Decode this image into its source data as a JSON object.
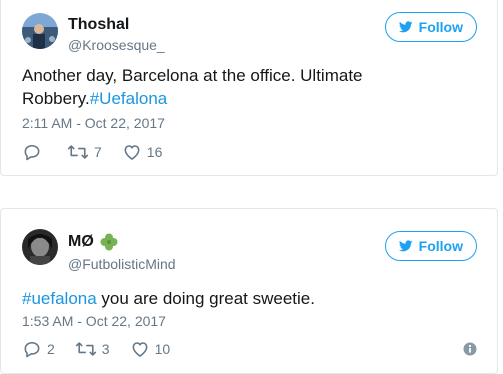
{
  "tweets": [
    {
      "name": "Thoshal",
      "handle": "@Kroosesque_",
      "follow_label": "Follow",
      "text_before": "Another day, Barcelona at the office. Ultimate Robbery.",
      "hashtag": "#Uefalona",
      "text_after": "",
      "timestamp": "2:11 AM - Oct 22, 2017",
      "reply_count": "",
      "retweet_count": "7",
      "like_count": "16",
      "avatar_icon": "crowd-photo"
    },
    {
      "name": "MØ",
      "name_emoji_icon": "four-leaf-clover-icon",
      "handle": "@FutbolisticMind",
      "follow_label": "Follow",
      "text_before": "",
      "hashtag": "#uefalona",
      "text_after": " you are doing great sweetie.",
      "timestamp": "1:53 AM - Oct 22, 2017",
      "reply_count": "2",
      "retweet_count": "3",
      "like_count": "10",
      "avatar_icon": "portrait-photo"
    }
  ],
  "colors": {
    "accent": "#1da1f2",
    "hashtag": "#1b95e0",
    "muted": "#657786",
    "clover": "#77b255"
  }
}
